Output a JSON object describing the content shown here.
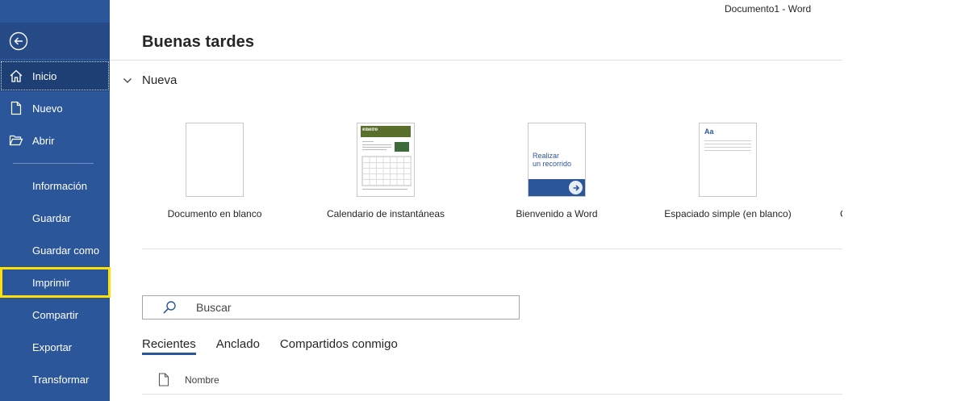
{
  "window": {
    "title": "Documento1  -  Word"
  },
  "sidebar": {
    "back_icon": "back-arrow-icon",
    "items": [
      {
        "label": "Inicio",
        "icon": "home-icon",
        "active": true
      },
      {
        "label": "Nuevo",
        "icon": "new-document-icon"
      },
      {
        "label": "Abrir",
        "icon": "open-folder-icon"
      },
      {
        "label": "Información"
      },
      {
        "label": "Guardar"
      },
      {
        "label": "Guardar como"
      },
      {
        "label": "Imprimir",
        "highlighted": true
      },
      {
        "label": "Compartir"
      },
      {
        "label": "Exportar"
      },
      {
        "label": "Transformar"
      }
    ]
  },
  "main": {
    "greeting": "Buenas tardes",
    "new_section": {
      "title": "Nueva",
      "templates": [
        {
          "label": "Documento en blanco"
        },
        {
          "label": "Calendario de instantáneas",
          "thumb_text": "enero"
        },
        {
          "label": "Bienvenido a Word",
          "thumb_text_line1": "Realizar",
          "thumb_text_line2": "un recorrido"
        },
        {
          "label": "Espaciado simple (en blanco)",
          "thumb_text": "Aa"
        }
      ],
      "partial_label": "C"
    },
    "search": {
      "placeholder": "Buscar"
    },
    "tabs": [
      {
        "label": "Recientes",
        "active": true
      },
      {
        "label": "Anclado"
      },
      {
        "label": "Compartidos conmigo"
      }
    ],
    "list": {
      "name_header": "Nombre"
    }
  },
  "colors": {
    "accent": "#2b579a",
    "highlight": "#ffe000"
  }
}
